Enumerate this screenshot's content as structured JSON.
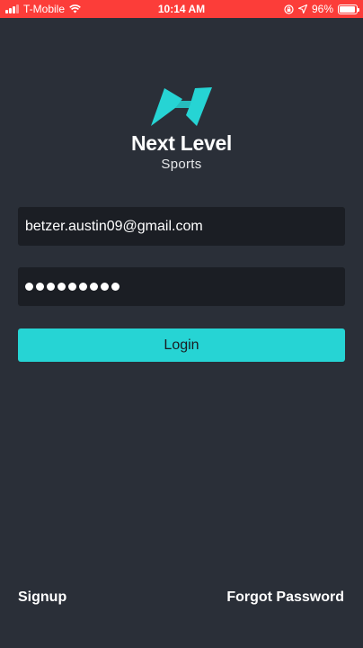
{
  "status_bar": {
    "carrier": "T-Mobile",
    "time": "10:14 AM",
    "battery": "96%",
    "battery_level": 0.96,
    "icons": [
      "signal-icon",
      "wifi-icon",
      "screen-lock-icon",
      "location-icon",
      "battery-icon"
    ]
  },
  "brand": {
    "logo": "next-level-logo-icon",
    "title": "Next Level",
    "subtitle": "Sports",
    "accent": "#26d4d4"
  },
  "form": {
    "email_value": "betzer.austin09@gmail.com",
    "password_mask_length": 9,
    "login_label": "Login"
  },
  "footer": {
    "signup_label": "Signup",
    "forgot_label": "Forgot Password"
  },
  "colors": {
    "background": "#2a2f38",
    "field_background": "#1b1e24",
    "status_bar": "#fc3d39"
  }
}
